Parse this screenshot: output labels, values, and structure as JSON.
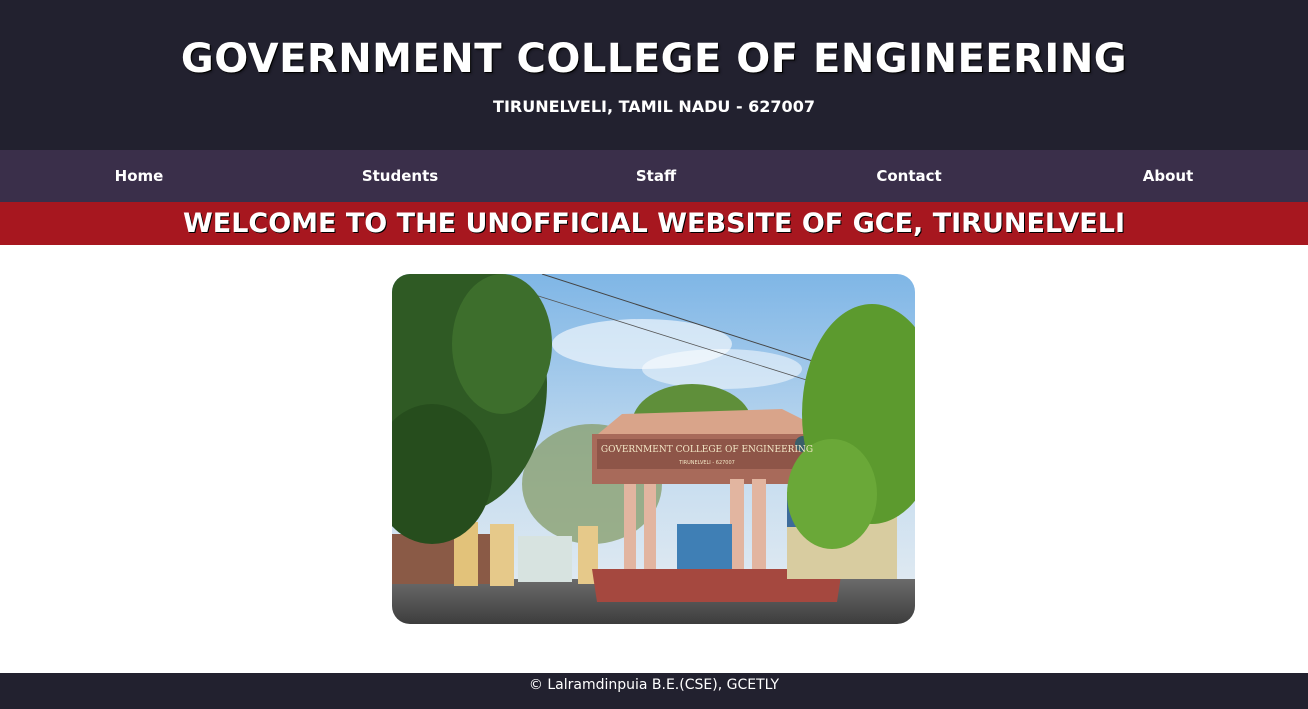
{
  "header": {
    "title": "GOVERNMENT COLLEGE OF ENGINEERING",
    "subtitle": "TIRUNELVELI, TAMIL NADU - 627007"
  },
  "nav": {
    "items": [
      {
        "label": "Home"
      },
      {
        "label": "Students"
      },
      {
        "label": "Staff"
      },
      {
        "label": "Contact"
      },
      {
        "label": "About"
      }
    ]
  },
  "banner": {
    "text": "WELCOME TO THE UNOFFICIAL WEBSITE OF GCE, TIRUNELVELI"
  },
  "photo": {
    "gate_sign": "GOVERNMENT COLLEGE OF ENGINEERING",
    "gate_subsign": "TIRUNELVELI - 627007"
  },
  "footer": {
    "text": "© Lalramdinpuia B.E.(CSE), GCETLY"
  },
  "colors": {
    "header_bg": "#22212f",
    "nav_bg": "#3a2f4a",
    "banner_bg": "#a7171f",
    "footer_bg": "#22212f",
    "text": "#ffffff"
  }
}
